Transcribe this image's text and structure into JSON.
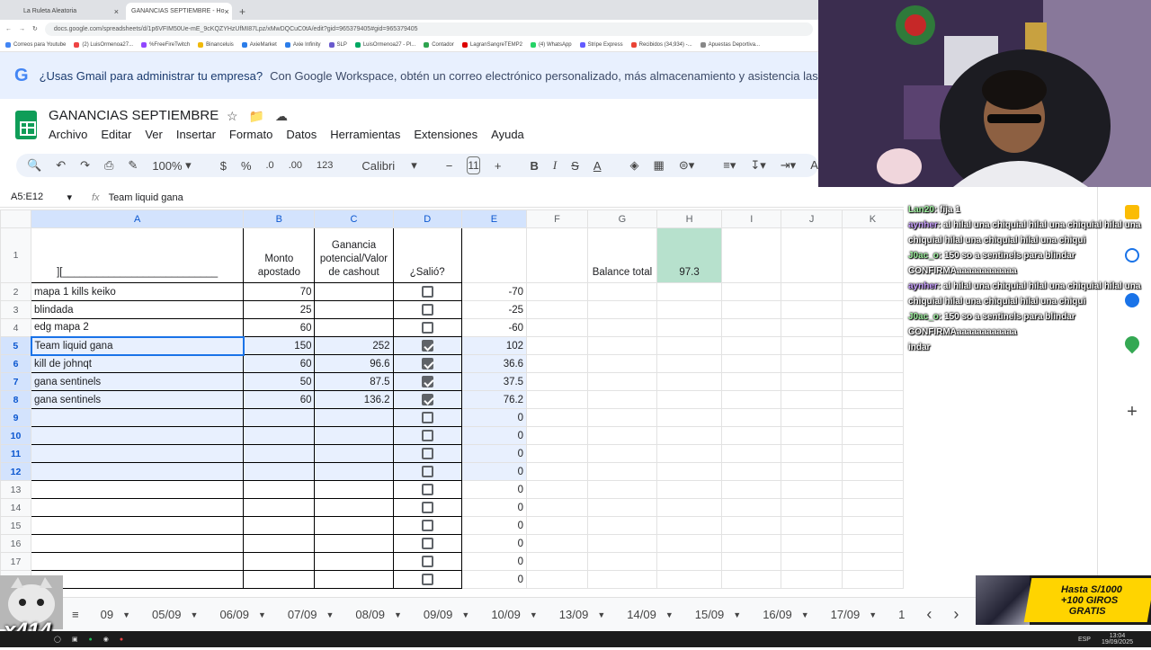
{
  "browser": {
    "tabs": [
      {
        "title": "La Ruleta Aleatoria",
        "active": false
      },
      {
        "title": "GANANCIAS SEPTIEMBRE - Ho",
        "active": true
      }
    ],
    "url": "docs.google.com/spreadsheets/d/1p6VFIM50Ue-mE_9cKQZYHzUfMI87Lpz/xMwDQCuC0tA/edit?gid=965379405#gid=965379405",
    "bookmarks": [
      "Correos para Youtube",
      "(2) LuisOrmenoa27...",
      "%FreeFireTwitch",
      "Binanceluis",
      "AxieMarket",
      "Axie Infinity",
      "SLP",
      "LuisOrmenoa27 - Pl...",
      "Contador",
      "LagranSangreTEMP2",
      "(4) WhatsApp",
      "Stripe Express",
      "Recibidos (34,934) -...",
      "Apuestas Deportiva..."
    ]
  },
  "banner": {
    "question": "¿Usas Gmail para administrar tu empresa?",
    "text": "Con Google Workspace, obtén un correo electrónico personalizado, más almacenamiento y asistencia las 24 ho"
  },
  "doc": {
    "title": "GANANCIAS SEPTIEMBRE",
    "menus": [
      "Archivo",
      "Editar",
      "Ver",
      "Insertar",
      "Formato",
      "Datos",
      "Herramientas",
      "Extensiones",
      "Ayuda"
    ]
  },
  "toolbar": {
    "zoom": "100%",
    "currency": "$",
    "percent": "%",
    "dec_less": ".0",
    "dec_more": ".00",
    "format": "123",
    "font": "Calibri",
    "font_size": "11"
  },
  "formula": {
    "namebox": "A5:E12",
    "fx": "fx",
    "content": "Team liquid gana"
  },
  "columns": [
    "A",
    "B",
    "C",
    "D",
    "E",
    "F",
    "G",
    "H",
    "I",
    "J",
    "K"
  ],
  "header_row": {
    "a": "][___________________________",
    "b": "Monto apostado",
    "c": "Ganancia potencial/Valor de cashout",
    "d": "¿Salió?",
    "g": "Balance total",
    "h": "97.3"
  },
  "rows": [
    {
      "n": "2",
      "a": "mapa 1 kills keiko",
      "b": "70",
      "c": "",
      "d": false,
      "e": "-70"
    },
    {
      "n": "3",
      "a": "blindada",
      "b": "25",
      "c": "",
      "d": false,
      "e": "-25"
    },
    {
      "n": "4",
      "a": "edg mapa 2",
      "b": "60",
      "c": "",
      "d": false,
      "e": "-60"
    },
    {
      "n": "5",
      "a": "Team liquid gana",
      "b": "150",
      "c": "252",
      "d": true,
      "e": "102"
    },
    {
      "n": "6",
      "a": "kill de johnqt",
      "b": "60",
      "c": "96.6",
      "d": true,
      "e": "36.6"
    },
    {
      "n": "7",
      "a": "gana sentinels",
      "b": "50",
      "c": "87.5",
      "d": true,
      "e": "37.5"
    },
    {
      "n": "8",
      "a": "gana sentinels",
      "b": "60",
      "c": "136.2",
      "d": true,
      "e": "76.2"
    },
    {
      "n": "9",
      "a": "",
      "b": "",
      "c": "",
      "d": false,
      "e": "0"
    },
    {
      "n": "10",
      "a": "",
      "b": "",
      "c": "",
      "d": false,
      "e": "0"
    },
    {
      "n": "11",
      "a": "",
      "b": "",
      "c": "",
      "d": false,
      "e": "0"
    },
    {
      "n": "12",
      "a": "",
      "b": "",
      "c": "",
      "d": false,
      "e": "0"
    },
    {
      "n": "13",
      "a": "",
      "b": "",
      "c": "",
      "d": false,
      "e": "0"
    },
    {
      "n": "14",
      "a": "",
      "b": "",
      "c": "",
      "d": false,
      "e": "0"
    },
    {
      "n": "15",
      "a": "",
      "b": "",
      "c": "",
      "d": false,
      "e": "0"
    },
    {
      "n": "16",
      "a": "",
      "b": "",
      "c": "",
      "d": false,
      "e": "0"
    },
    {
      "n": "17",
      "a": "",
      "b": "",
      "c": "",
      "d": false,
      "e": "0"
    },
    {
      "n": "18",
      "a": "",
      "b": "",
      "c": "",
      "d": false,
      "e": "0"
    }
  ],
  "chat": [
    {
      "user": "Lan20",
      "msg": ": fija 1",
      "color": "#9ff0a0"
    },
    {
      "user": "aynher",
      "msg": ": al hilal una chiquial hilal una chiquial hilal una chiquial hilal una chiquial hilal una chiqui",
      "color": "#c9a0ff"
    },
    {
      "user": "J0ac_o",
      "msg": ": 150 so a sentinels para blindar CONFIRMAaaaaaaaaaaaa",
      "color": "#9ff0a0"
    },
    {
      "user": "aynher",
      "msg": ": al hilal una chiquial hilal una chiquial hilal una chiquial hilal una chiquial hilal una chiqui",
      "color": "#c9a0ff"
    },
    {
      "user": "J0ac_o",
      "msg": ": 150 so a sentinels para blindar CONFIRMAaaaaaaaaaaaa",
      "color": "#9ff0a0"
    },
    {
      "user": "",
      "msg": "indar",
      "color": "#ffffff"
    }
  ],
  "sheet_tabs": [
    "09",
    "05/09",
    "06/09",
    "07/09",
    "08/09",
    "09/09",
    "10/09",
    "13/09",
    "14/09",
    "15/09",
    "16/09",
    "17/09",
    "1"
  ],
  "overlay": {
    "cat_label": "x414",
    "promo_line1": "Hasta S/1000",
    "promo_line2": "+100 GIROS",
    "promo_line3": "GRATIS"
  },
  "clock": {
    "time": "13:04",
    "date": "19/09/2025",
    "lang": "ESP"
  }
}
